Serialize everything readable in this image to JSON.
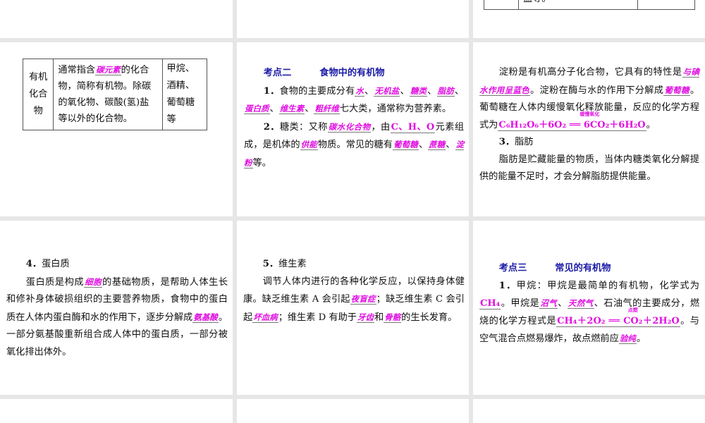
{
  "slides": {
    "s1": {},
    "s2": {},
    "s3": {
      "table_tail": "盐等。"
    },
    "s4": {
      "table": {
        "term": "有机化合物",
        "definition": [
          {
            "t": "通常指含"
          },
          {
            "t": "碳元素",
            "h": 1
          },
          {
            "t": "的化合物，简称有机物。除碳的氧化物、碳酸(氢)盐等以外的化合物。"
          }
        ],
        "examples": "甲烷、酒精、葡萄糖等"
      }
    },
    "s5": {
      "heading_label": "考点二",
      "heading_title": "食物中的有机物",
      "paragraphs": [
        [
          {
            "t": "1．",
            "b": 1
          },
          {
            "t": "食物的主要成分有"
          },
          {
            "t": "水",
            "h": 1
          },
          {
            "t": "、"
          },
          {
            "t": "无机盐",
            "h": 1
          },
          {
            "t": "、"
          },
          {
            "t": "糖类",
            "h": 1
          },
          {
            "t": "、"
          },
          {
            "t": "脂肪",
            "h": 1
          },
          {
            "t": "、"
          },
          {
            "t": "蛋白质",
            "h": 1
          },
          {
            "t": "、"
          },
          {
            "t": "维生素",
            "h": 1
          },
          {
            "t": "、"
          },
          {
            "t": "粗纤维",
            "h": 1
          },
          {
            "t": "七大类，通常称为营养素。"
          }
        ],
        [
          {
            "t": "2．",
            "b": 1
          },
          {
            "t": "糖类：又称"
          },
          {
            "t": "碳水化合物",
            "h": 1
          },
          {
            "t": "，由"
          },
          {
            "t": "C、H、O",
            "h": 2
          },
          {
            "t": "元素组成，是机体的"
          },
          {
            "t": "供能",
            "h": 1
          },
          {
            "t": "物质。常见的糖有"
          },
          {
            "t": "葡萄糖",
            "h": 1
          },
          {
            "t": "、"
          },
          {
            "t": "蔗糖",
            "h": 1
          },
          {
            "t": "、"
          },
          {
            "t": "淀粉",
            "h": 1
          },
          {
            "t": "等。"
          }
        ]
      ]
    },
    "s6": {
      "paragraphs": [
        [
          {
            "t": "淀粉是有机高分子化合物，它具有的特性是"
          },
          {
            "t": "与碘水作用呈蓝色",
            "h": 1
          },
          {
            "t": "。淀粉在酶与水的作用下分解成"
          },
          {
            "t": "葡萄糖",
            "h": 1
          },
          {
            "t": "。葡萄糖在人体内缓慢氧化释放能量，反应的化学方程式为"
          },
          {
            "t": "C₆H₁₂O₆＋6O₂ ══ 6CO₂＋6H₂O",
            "h": 2,
            "cond": "缓慢氧化"
          },
          {
            "t": "。"
          }
        ],
        [
          {
            "t": "3．",
            "b": 1
          },
          {
            "t": "脂肪"
          }
        ],
        [
          {
            "t": "脂肪是贮藏能量的物质，当体内糖类氧化分解提供的能量不足时，才会分解脂肪提供能量。"
          }
        ]
      ]
    },
    "s7": {
      "paragraphs": [
        [
          {
            "t": "4．",
            "b": 1
          },
          {
            "t": "蛋白质"
          }
        ],
        [
          {
            "t": "蛋白质是构成"
          },
          {
            "t": "细胞",
            "h": 1
          },
          {
            "t": "的基础物质，是帮助人体生长和修补身体破损组织的主要营养物质，食物中的蛋白质在人体内蛋白酶和水的作用下，逐步分解成"
          },
          {
            "t": "氨基酸",
            "h": 1
          },
          {
            "t": "。一部分氨基酸重新组合成人体中的蛋白质，一部分被氧化排出体外。"
          }
        ]
      ]
    },
    "s8": {
      "paragraphs": [
        [
          {
            "t": "5．",
            "b": 1
          },
          {
            "t": "维生素"
          }
        ],
        [
          {
            "t": "调节人体内进行的各种化学反应，以保持身体健康。缺乏维生素 A 会引起"
          },
          {
            "t": "夜盲症",
            "h": 1
          },
          {
            "t": "；缺乏维生素 C 会引起"
          },
          {
            "t": "坏血病",
            "h": 1
          },
          {
            "t": "；维生素 D 有助于"
          },
          {
            "t": "牙齿",
            "h": 1
          },
          {
            "t": "和"
          },
          {
            "t": "骨骼",
            "h": 1
          },
          {
            "t": "的生长发育。"
          }
        ]
      ]
    },
    "s9": {
      "heading_label": "考点三",
      "heading_title": "常见的有机物",
      "paragraphs": [
        [
          {
            "t": "1．",
            "b": 1
          },
          {
            "t": "甲烷：甲烷是最简单的有机物，化学式为"
          },
          {
            "t": "CH₄",
            "h": 2
          },
          {
            "t": "。甲烷是"
          },
          {
            "t": "沼气",
            "h": 1
          },
          {
            "t": "、"
          },
          {
            "t": "天然气",
            "h": 1
          },
          {
            "t": "、石油气的主要成分，燃烧的化学方程式是"
          },
          {
            "t": "CH₄＋2O₂ ══ CO₂＋2H₂O",
            "h": 2,
            "cond": "点燃"
          },
          {
            "t": "。与空气混合点燃易爆炸，故点燃前应"
          },
          {
            "t": "验纯",
            "h": 1
          },
          {
            "t": "。"
          }
        ]
      ]
    }
  },
  "colors": {
    "highlight": "#e010e0",
    "heading": "#1c1ca8"
  }
}
